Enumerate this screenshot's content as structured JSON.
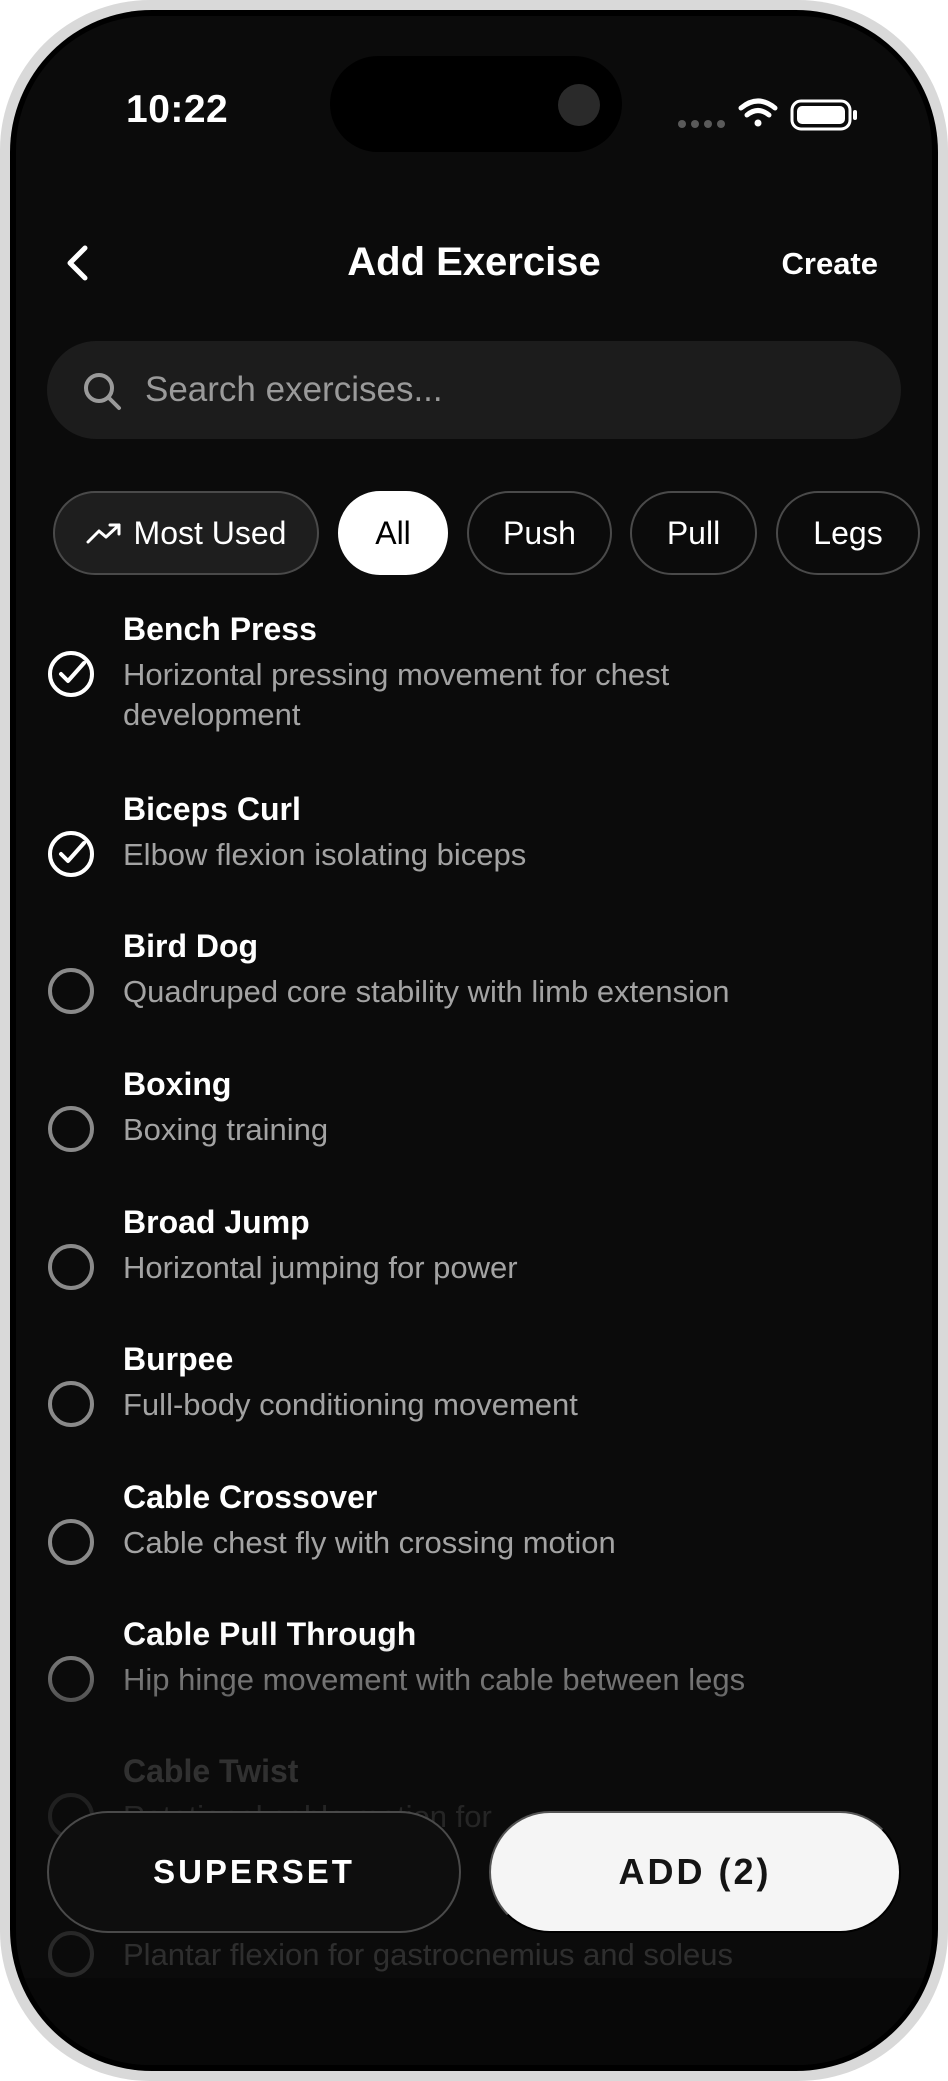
{
  "status_bar": {
    "time": "10:22",
    "icons": [
      "signal-icon",
      "wifi-icon",
      "battery-icon"
    ]
  },
  "nav": {
    "back_icon": "chevron-left-icon",
    "title": "Add Exercise",
    "create_label": "Create"
  },
  "search": {
    "placeholder": "Search exercises...",
    "value": ""
  },
  "filters": [
    {
      "label": "Most Used",
      "icon": "trending-up-icon",
      "selected": false
    },
    {
      "label": "All",
      "selected": true
    },
    {
      "label": "Push",
      "selected": false
    },
    {
      "label": "Pull",
      "selected": false
    },
    {
      "label": "Legs",
      "selected": false
    }
  ],
  "exercises": [
    {
      "name": "Bench Press",
      "desc": "Horizontal pressing movement for chest development",
      "checked": true
    },
    {
      "name": "Biceps Curl",
      "desc": "Elbow flexion isolating biceps",
      "checked": true
    },
    {
      "name": "Bird Dog",
      "desc": "Quadruped core stability with limb extension",
      "checked": false
    },
    {
      "name": "Boxing",
      "desc": "Boxing training",
      "checked": false
    },
    {
      "name": "Broad Jump",
      "desc": "Horizontal jumping for power",
      "checked": false
    },
    {
      "name": "Burpee",
      "desc": "Full-body conditioning movement",
      "checked": false
    },
    {
      "name": "Cable Crossover",
      "desc": "Cable chest fly with crossing motion",
      "checked": false
    },
    {
      "name": "Cable Pull Through",
      "desc": "Hip hinge movement with cable between legs",
      "checked": false
    },
    {
      "name": "Cable Twist",
      "desc": "Rotational cable motion for",
      "checked": false
    },
    {
      "name": "",
      "desc": "Plantar flexion for gastrocnemius and soleus",
      "checked": false
    }
  ],
  "actions": {
    "superset_label": "SUPERSET",
    "add_label": "ADD (2)"
  },
  "colors": {
    "background": "#0b0b0b",
    "surface": "#1c1c1c",
    "text_primary": "#ffffff",
    "text_secondary": "#a3a3a3",
    "border": "#4a4a4a",
    "accent_light": "#f5f5f5"
  }
}
